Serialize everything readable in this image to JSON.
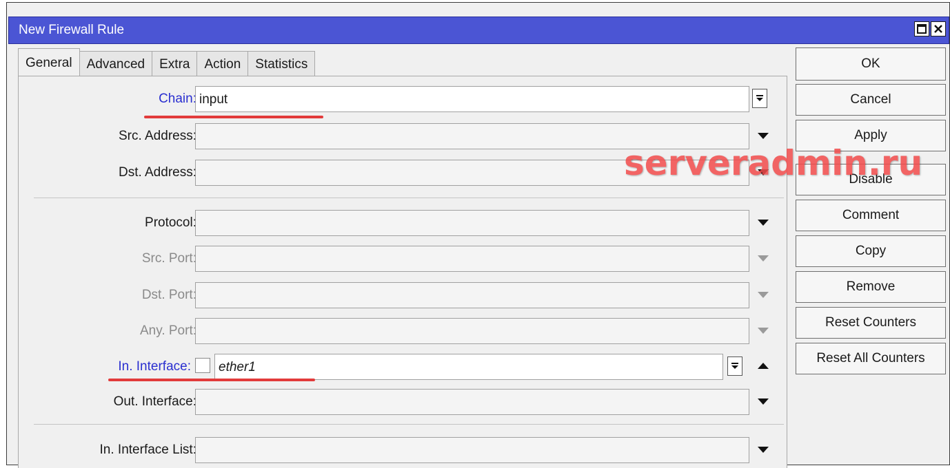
{
  "window": {
    "title": "New Firewall Rule",
    "title_bar_color": "#4b55d4",
    "controls": [
      "maximize-icon",
      "close-icon"
    ]
  },
  "tabs": [
    {
      "label": "General",
      "active": true
    },
    {
      "label": "Advanced",
      "active": false
    },
    {
      "label": "Extra",
      "active": false
    },
    {
      "label": "Action",
      "active": false
    },
    {
      "label": "Statistics",
      "active": false
    }
  ],
  "fields": {
    "chain": {
      "label": "Chain:",
      "value": "input"
    },
    "src_address": {
      "label": "Src. Address:",
      "value": ""
    },
    "dst_address": {
      "label": "Dst. Address:",
      "value": ""
    },
    "protocol": {
      "label": "Protocol:",
      "value": ""
    },
    "src_port": {
      "label": "Src. Port:",
      "value": ""
    },
    "dst_port": {
      "label": "Dst. Port:",
      "value": ""
    },
    "any_port": {
      "label": "Any. Port:",
      "value": ""
    },
    "in_interface": {
      "label": "In. Interface:",
      "value": "ether1",
      "negate": false
    },
    "out_interface": {
      "label": "Out. Interface:",
      "value": ""
    },
    "in_interface_list": {
      "label": "In. Interface List:",
      "value": ""
    }
  },
  "buttons": {
    "ok": "OK",
    "cancel": "Cancel",
    "apply": "Apply",
    "disable": "Disable",
    "comment": "Comment",
    "copy": "Copy",
    "remove": "Remove",
    "reset_counters": "Reset Counters",
    "reset_all_counters": "Reset All Counters"
  },
  "watermark": "serveradmin.ru",
  "colors": {
    "accent_label": "#2a2fd0",
    "disabled_label": "#8a8a8a",
    "annotation_underline": "#e23b3b"
  }
}
